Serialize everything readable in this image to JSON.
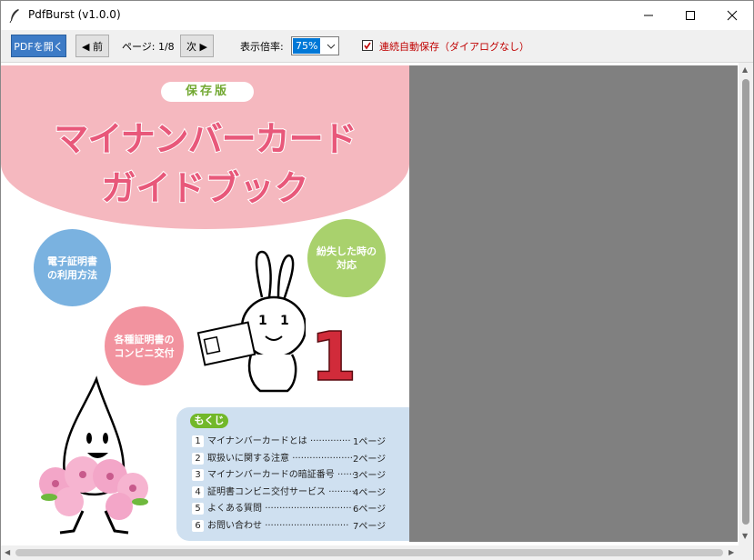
{
  "window": {
    "title": "PdfBurst (v1.0.0)"
  },
  "toolbar": {
    "open_label": "PDFを開く",
    "prev_label": "◀ 前",
    "page_indicator": "ページ: 1/8",
    "next_label": "次 ▶",
    "zoom_label": "表示倍率:",
    "zoom_value": "75%",
    "autosave_label": "連続自動保存（ダイアログなし）",
    "autosave_checked": true
  },
  "document": {
    "banner": "保存版",
    "title_line1": "マイナンバーカード",
    "title_line2": "ガイドブック",
    "bubble_cert_usage": [
      "電子証明書",
      "の利用方法"
    ],
    "bubble_lost": [
      "紛失した時の",
      "対応"
    ],
    "bubble_convenience": [
      "各種証明書の",
      "コンビニ交付"
    ],
    "mascot_number": "1",
    "toc_header": "もくじ",
    "toc": [
      {
        "num": "1",
        "title": "マイナンバーカードとは",
        "dots": "··············",
        "page": "1ページ"
      },
      {
        "num": "2",
        "title": "取扱いに関する注意",
        "dots": "·····················",
        "page": "2ページ"
      },
      {
        "num": "3",
        "title": "マイナンバーカードの暗証番号",
        "dots": "······",
        "page": "3ページ"
      },
      {
        "num": "4",
        "title": "証明書コンビニ交付サービス",
        "dots": "·········",
        "page": "4ページ"
      },
      {
        "num": "5",
        "title": "よくある質問",
        "dots": "······························",
        "page": "6ページ"
      },
      {
        "num": "6",
        "title": "お問い合わせ",
        "dots": "·····························",
        "page": "7ページ"
      }
    ]
  },
  "colors": {
    "accent": "#3d7bc6",
    "pink": "#f5b8bf",
    "title_pink": "#e8587a",
    "bubble_blue": "#7ab2e0",
    "bubble_green": "#a9d16d",
    "bubble_pink": "#f2939f",
    "toc_bg": "#cfe0f0",
    "viewer_gray": "#808080"
  }
}
